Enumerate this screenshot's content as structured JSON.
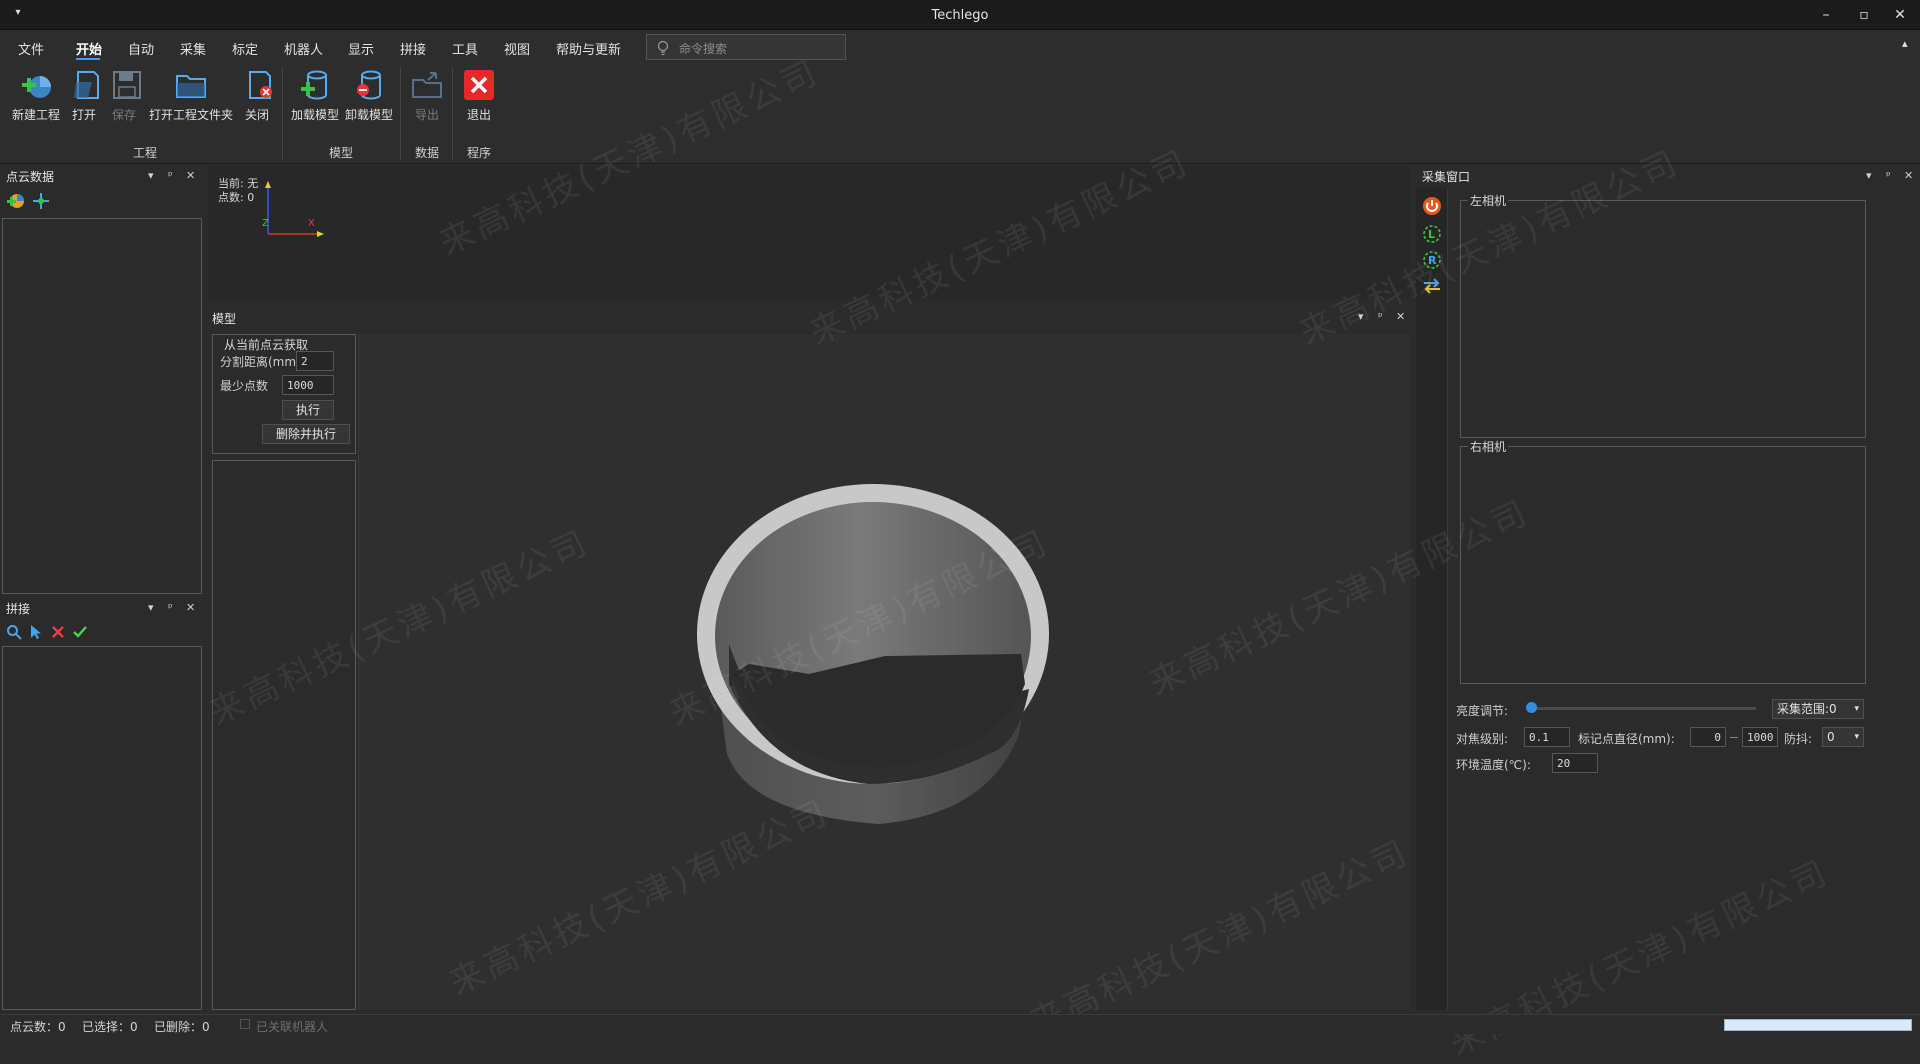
{
  "window": {
    "title": "Techlego",
    "menu_glyph": "▾",
    "minimize": "–",
    "restore": "▫",
    "close": "✕"
  },
  "menu": {
    "items": [
      "文件",
      "开始",
      "自动",
      "采集",
      "标定",
      "机器人",
      "显示",
      "拼接",
      "工具",
      "视图",
      "帮助与更新"
    ],
    "active": "开始",
    "search_placeholder": "命令搜索",
    "collapse_glyph": "▴"
  },
  "ribbon": {
    "buttons": {
      "new_project": "新建工程",
      "open": "打开",
      "save": "保存",
      "open_folder": "打开工程文件夹",
      "close": "关闭",
      "load_model": "加载模型",
      "unload_model": "卸载模型",
      "export": "导出",
      "exit": "退出"
    },
    "groups": {
      "project": "工程",
      "model": "模型",
      "data": "数据",
      "program": "程序"
    }
  },
  "pointcloud_panel": {
    "title": "点云数据"
  },
  "stitch_panel": {
    "title": "拼接"
  },
  "viewport_info": {
    "current": "当前: 无",
    "points": "点数: 0",
    "axis_z": "Z",
    "axis_x": "X"
  },
  "model_panel": {
    "title": "模型",
    "group_title": "从当前点云获取",
    "split_distance_label": "分割距离(mm)",
    "split_distance_value": "2",
    "min_points_label": "最少点数",
    "min_points_value": "1000",
    "execute_button": "执行",
    "delete_execute_button": "删除并执行"
  },
  "capture_panel": {
    "title": "采集窗口",
    "left_camera": "左相机",
    "right_camera": "右相机",
    "brightness_label": "亮度调节:",
    "range_label": "采集范围:",
    "range_value": "0",
    "focus_label": "对焦级别:",
    "focus_value": "0.1",
    "marker_label": "标记点直径(mm):",
    "marker_min": "0",
    "marker_max": "1000",
    "antishake_label": "防抖:",
    "antishake_value": "0",
    "temp_label": "环境温度(℃):",
    "temp_value": "20"
  },
  "status": {
    "points": "点云数：0",
    "selected": "已选择：0",
    "deleted": "已删除：0",
    "robot": "已关联机器人"
  },
  "watermark": "来高科技(天津)有限公司",
  "dock_glyphs": {
    "menu": "▾",
    "pin": "ᵖ",
    "close": "✕"
  },
  "colors": {
    "accent": "#3d9bff",
    "exit": "#e82727",
    "background": "#2b2b2b"
  }
}
